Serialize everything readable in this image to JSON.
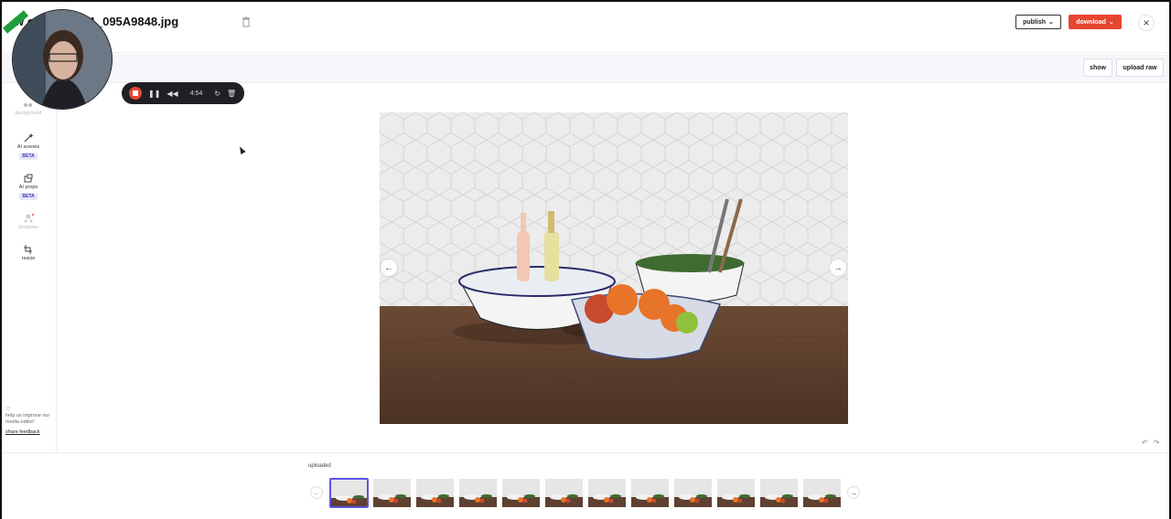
{
  "header": {
    "title": "w                on Home_r1_095A9848.jpg",
    "publish_label": "publish",
    "download_label": "download",
    "close_icon": "close-icon"
  },
  "toolbar": {
    "show_label": "show",
    "upload_raw_label": "upload raw"
  },
  "sidebar": {
    "tools": [
      {
        "label": "background",
        "icon": "background-icon"
      },
      {
        "label": "AI scenes",
        "icon": "magic-wand-icon",
        "badge": "BETA"
      },
      {
        "label": "AI props",
        "icon": "props-icon",
        "badge": "BETA"
      },
      {
        "label": "shadows",
        "icon": "shadows-icon"
      },
      {
        "label": "resize",
        "icon": "crop-icon"
      }
    ],
    "feedback_text": "help us improve our media editor!",
    "feedback_link": "share feedback"
  },
  "recorder": {
    "time": "4:54"
  },
  "filmstrip": {
    "label": "uploaded",
    "thumbnail_count": 12,
    "selected_index": 0
  },
  "colors": {
    "accent_red": "#e54632",
    "selection": "#5a55e0",
    "beta_bg": "#e7e7fb"
  }
}
